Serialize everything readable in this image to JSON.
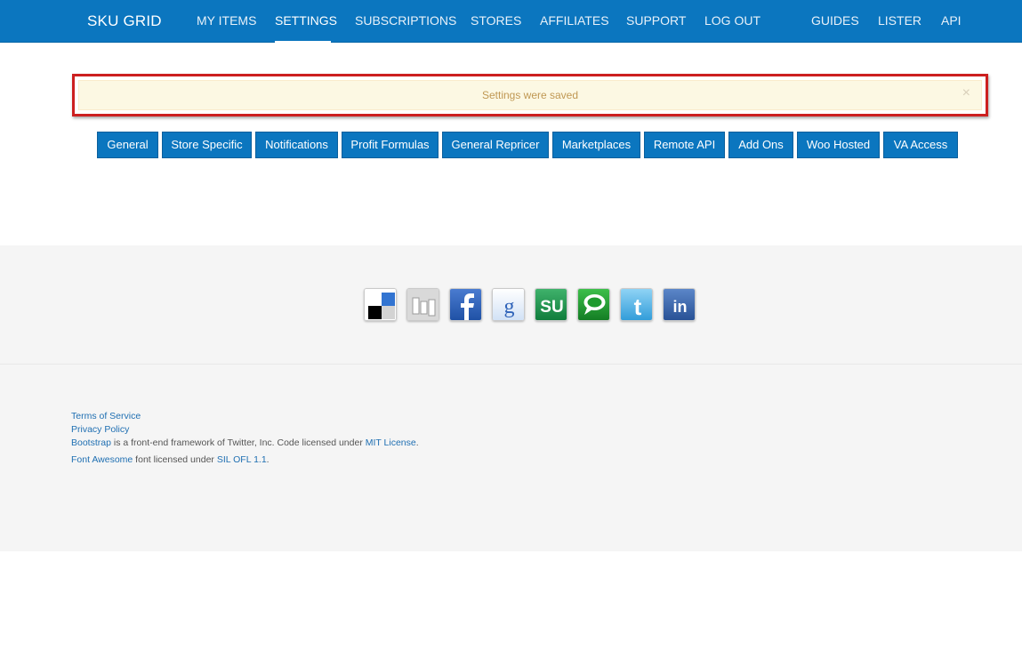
{
  "navbar": {
    "brand": "SKU GRID",
    "items": [
      {
        "label": "MY ITEMS"
      },
      {
        "label": "SETTINGS",
        "active": true
      },
      {
        "label": "SUBSCRIPTIONS"
      },
      {
        "label": "STORES"
      },
      {
        "label": "AFFILIATES"
      },
      {
        "label": "SUPPORT"
      },
      {
        "label": "LOG OUT"
      }
    ],
    "right_items": [
      {
        "label": "GUIDES"
      },
      {
        "label": "LISTER"
      },
      {
        "label": "API"
      }
    ]
  },
  "alert": {
    "message": "Settings were saved",
    "close": "×"
  },
  "tabs": [
    {
      "label": "General"
    },
    {
      "label": "Store Specific"
    },
    {
      "label": "Notifications"
    },
    {
      "label": "Profit Formulas"
    },
    {
      "label": "General Repricer"
    },
    {
      "label": "Marketplaces"
    },
    {
      "label": "Remote API"
    },
    {
      "label": "Add Ons"
    },
    {
      "label": "Woo Hosted"
    },
    {
      "label": "VA Access"
    }
  ],
  "social_icons": [
    "delicious-icon",
    "digg-icon",
    "facebook-icon",
    "google-icon",
    "stumbleupon-icon",
    "technorati-icon",
    "twitter-icon",
    "linkedin-icon"
  ],
  "footer": {
    "terms": "Terms of Service",
    "privacy": "Privacy Policy",
    "bootstrap_link": "Bootstrap",
    "bootstrap_text": " is a front-end framework of Twitter, Inc. Code licensed under ",
    "mit_link": "MIT License",
    "period1": ".",
    "fa_link": "Font Awesome",
    "fa_text": " font licensed under ",
    "ofl_link": "SIL OFL 1.1",
    "period2": "."
  },
  "colors": {
    "nav_blue": "#0b76bf",
    "alert_bg": "#fcf8e3",
    "alert_text": "#c09853",
    "highlight_red": "#cc1f1f",
    "footer_bg": "#f5f5f5"
  }
}
